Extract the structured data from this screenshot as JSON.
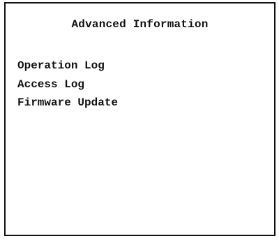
{
  "screen": {
    "title": "Advanced Information",
    "menu_items": [
      {
        "label": "Operation Log"
      },
      {
        "label": "Access Log"
      },
      {
        "label": "Firmware Update"
      }
    ]
  },
  "colors": {
    "border": "#111111",
    "text": "#111111",
    "background": "#ffffff"
  }
}
